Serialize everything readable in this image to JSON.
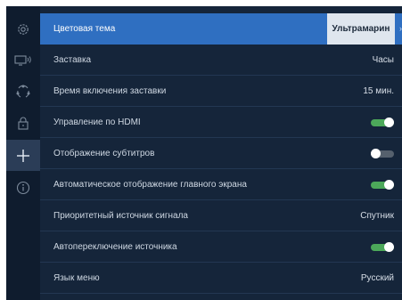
{
  "sidebar": {
    "items": [
      {
        "icon": "gear-icon",
        "active": false
      },
      {
        "icon": "tv-wireless-icon",
        "active": false
      },
      {
        "icon": "network-icon",
        "active": false
      },
      {
        "icon": "lock-icon",
        "active": false
      },
      {
        "icon": "plus-icon",
        "active": true
      },
      {
        "icon": "info-icon",
        "active": false
      }
    ]
  },
  "settings": {
    "rows": [
      {
        "label": "Цветовая тема",
        "value": "Ультрамарин",
        "type": "select",
        "selected": true
      },
      {
        "label": "Заставка",
        "value": "Часы",
        "type": "value"
      },
      {
        "label": "Время включения заставки",
        "value": "15 мин.",
        "type": "value"
      },
      {
        "label": "Управление по HDMI",
        "type": "toggle",
        "on": true
      },
      {
        "label": "Отображение субтитров",
        "type": "toggle",
        "on": false
      },
      {
        "label": "Автоматическое отображение главного экрана",
        "type": "toggle",
        "on": true
      },
      {
        "label": "Приоритетный источник сигнала",
        "value": "Спутник",
        "type": "value"
      },
      {
        "label": "Автопереключение источника",
        "type": "toggle",
        "on": true
      },
      {
        "label": "Язык меню",
        "value": "Русский",
        "type": "value"
      }
    ]
  },
  "colors": {
    "background": "#15253a",
    "sidebar": "#0f1c2e",
    "selected_row": "#2f6fc1",
    "toggle_on": "#4ca85a",
    "toggle_off": "#55606d"
  }
}
